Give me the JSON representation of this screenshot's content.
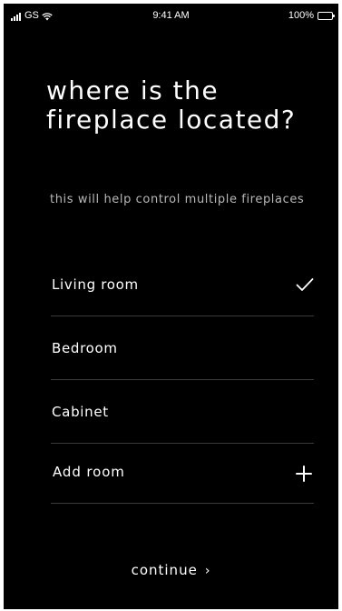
{
  "status_bar": {
    "carrier": "GS",
    "time": "9:41 AM",
    "battery": "100%"
  },
  "title": "where is the fireplace located?",
  "subtitle": "this will help control multiple fireplaces",
  "options": [
    {
      "label": "Living room",
      "selected": true
    },
    {
      "label": "Bedroom",
      "selected": false
    },
    {
      "label": "Cabinet",
      "selected": false
    }
  ],
  "add_room_label": "Add room",
  "continue_label": "continue",
  "continue_chevron": "›",
  "icons": {
    "selected": "checkmark-icon",
    "add": "plus-icon",
    "continue": "chevron-right-icon"
  },
  "colors": {
    "background": "#000000",
    "text": "#ffffff",
    "subtitle": "#b8b8b8",
    "divider": "#3a3a3a"
  }
}
